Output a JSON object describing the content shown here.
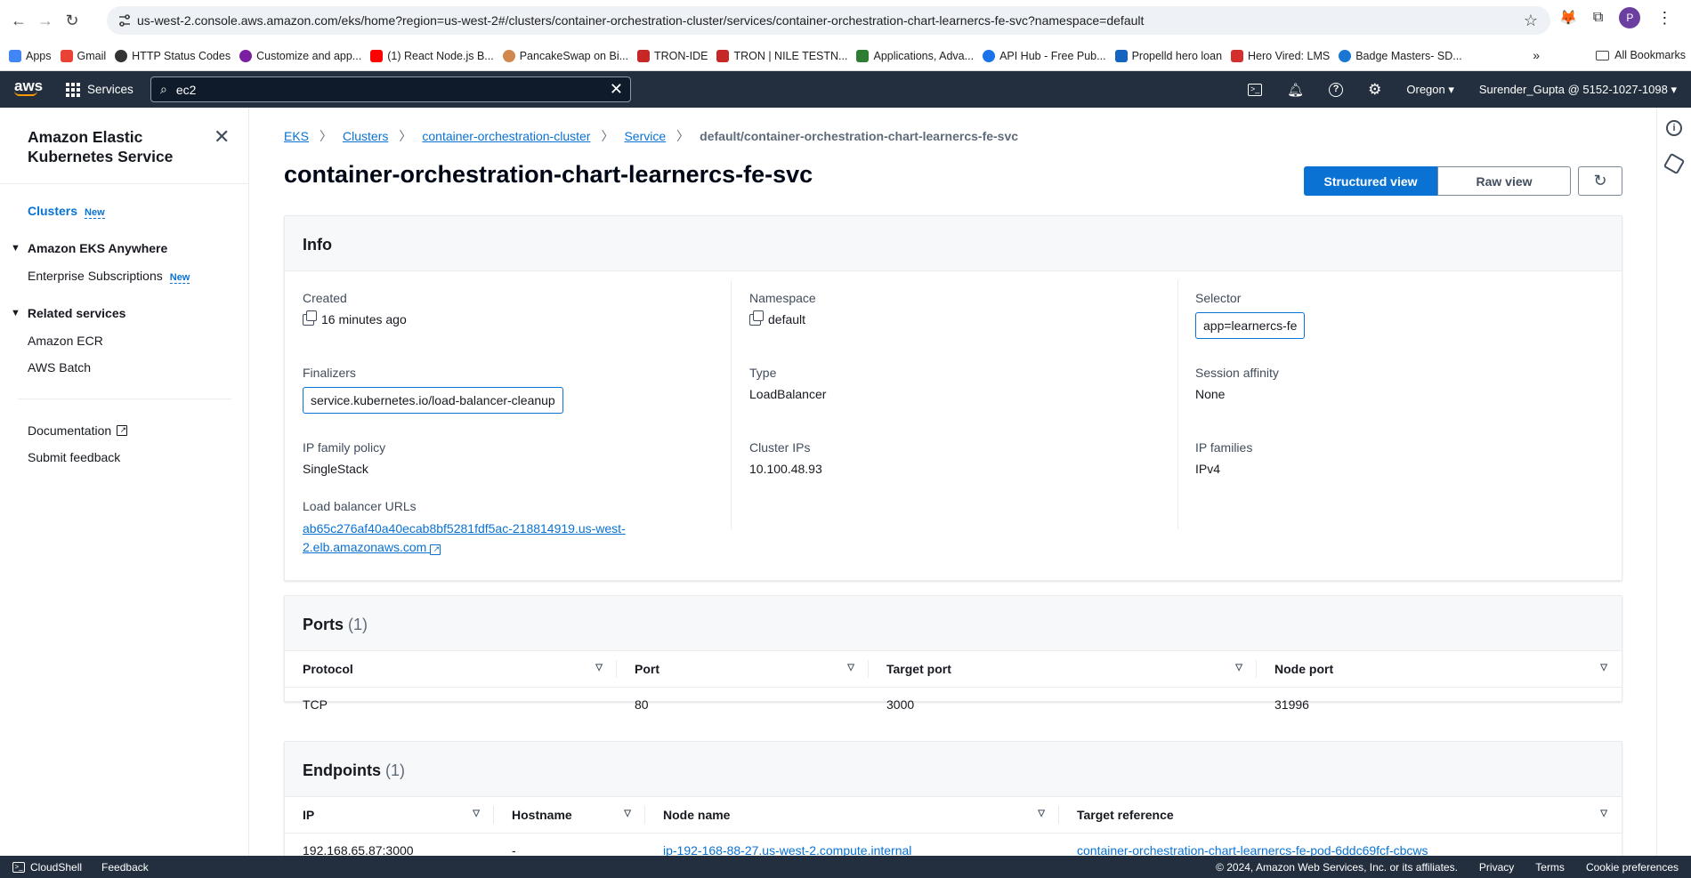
{
  "browser": {
    "url": "us-west-2.console.aws.amazon.com/eks/home?region=us-west-2#/clusters/container-orchestration-cluster/services/container-orchestration-chart-learnercs-fe-svc?namespace=default",
    "profile_initial": "P"
  },
  "bookmarks": {
    "items": [
      {
        "label": "Apps",
        "color": "#4285f4"
      },
      {
        "label": "Gmail",
        "color": "#ea4335"
      },
      {
        "label": "HTTP Status Codes",
        "color": "#333333"
      },
      {
        "label": "Customize and app...",
        "color": "#7b1fa2"
      },
      {
        "label": "(1) React Node.js B...",
        "color": "#ff0000"
      },
      {
        "label": "PancakeSwap on Bi...",
        "color": "#d1884f"
      },
      {
        "label": "TRON-IDE",
        "color": "#c62828"
      },
      {
        "label": "TRON | NILE TESTN...",
        "color": "#c62828"
      },
      {
        "label": "Applications, Adva...",
        "color": "#2e7d32"
      },
      {
        "label": "API Hub - Free Pub...",
        "color": "#1a73e8"
      },
      {
        "label": "Propelld hero loan",
        "color": "#1565c0"
      },
      {
        "label": "Hero Vired: LMS",
        "color": "#d32f2f"
      },
      {
        "label": "Badge Masters- SD...",
        "color": "#1976d2"
      }
    ],
    "more": "»",
    "all": "All Bookmarks"
  },
  "aws": {
    "logo": "aws",
    "services": "Services",
    "search_value": "ec2",
    "region": "Oregon",
    "account": "Surender_Gupta @ 5152-1027-1098"
  },
  "sidebar": {
    "title": "Amazon Elastic Kubernetes Service",
    "clusters": "Clusters",
    "new": "New",
    "anywhere": "Amazon EKS Anywhere",
    "enterprise": "Enterprise Subscriptions",
    "related": "Related services",
    "ecr": "Amazon ECR",
    "batch": "AWS Batch",
    "docs": "Documentation",
    "feedback": "Submit feedback"
  },
  "breadcrumb": {
    "eks": "EKS",
    "clusters": "Clusters",
    "cluster": "container-orchestration-cluster",
    "service": "Service",
    "current": "default/container-orchestration-chart-learnercs-fe-svc"
  },
  "page": {
    "title": "container-orchestration-chart-learnercs-fe-svc",
    "structured": "Structured view",
    "raw": "Raw view"
  },
  "info": {
    "heading": "Info",
    "created_k": "Created",
    "created_v": "16 minutes ago",
    "namespace_k": "Namespace",
    "namespace_v": "default",
    "selector_k": "Selector",
    "selector_v": "app=learnercs-fe",
    "finalizers_k": "Finalizers",
    "finalizers_v": "service.kubernetes.io/load-balancer-cleanup",
    "type_k": "Type",
    "type_v": "LoadBalancer",
    "affinity_k": "Session affinity",
    "affinity_v": "None",
    "ipfam_k": "IP family policy",
    "ipfam_v": "SingleStack",
    "clusterips_k": "Cluster IPs",
    "clusterips_v": "10.100.48.93",
    "ipfamilies_k": "IP families",
    "ipfamilies_v": "IPv4",
    "lb_k": "Load balancer URLs",
    "lb_v1": "ab65c276af40a40ecab8bf5281fdf5ac-218814919.us-west-",
    "lb_v2": "2.elb.amazonaws.com"
  },
  "ports": {
    "heading": "Ports",
    "count": "(1)",
    "headers": [
      "Protocol",
      "Port",
      "Target port",
      "Node port"
    ],
    "rows": [
      [
        "TCP",
        "80",
        "3000",
        "31996"
      ]
    ]
  },
  "endpoints": {
    "heading": "Endpoints",
    "count": "(1)",
    "headers": [
      "IP",
      "Hostname",
      "Node name",
      "Target reference"
    ],
    "rows": [
      [
        "192.168.65.87:3000",
        "-",
        "ip-192-168-88-27.us-west-2.compute.internal",
        "container-orchestration-chart-learnercs-fe-pod-6ddc69fcf-cbcws"
      ]
    ]
  },
  "footer": {
    "cloudshell": "CloudShell",
    "feedback": "Feedback",
    "copyright": "© 2024, Amazon Web Services, Inc. or its affiliates.",
    "privacy": "Privacy",
    "terms": "Terms",
    "cookies": "Cookie preferences"
  }
}
